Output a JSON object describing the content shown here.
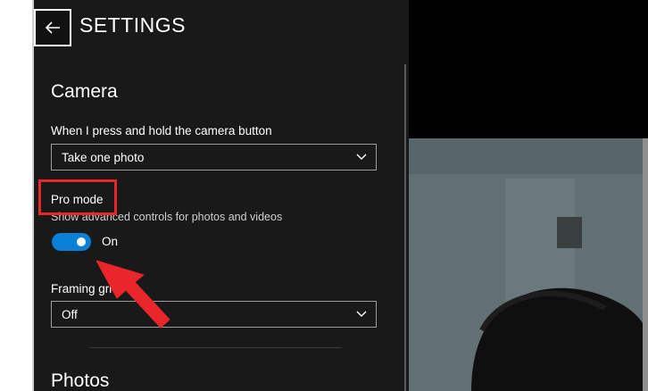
{
  "header": {
    "title": "SETTINGS"
  },
  "camera_section": {
    "title": "Camera",
    "hold_label": "When I press and hold the camera button",
    "hold_value": "Take one photo",
    "pro_mode_label": "Pro mode",
    "pro_mode_description": "Show advanced controls for photos and videos",
    "pro_mode_state": "On",
    "framing_label": "Framing gri",
    "framing_value": "Off"
  },
  "photos_section": {
    "title": "Photos"
  },
  "colors": {
    "accent": "#0a7fd6",
    "annotation": "#e8262b",
    "panel": "#191919"
  }
}
